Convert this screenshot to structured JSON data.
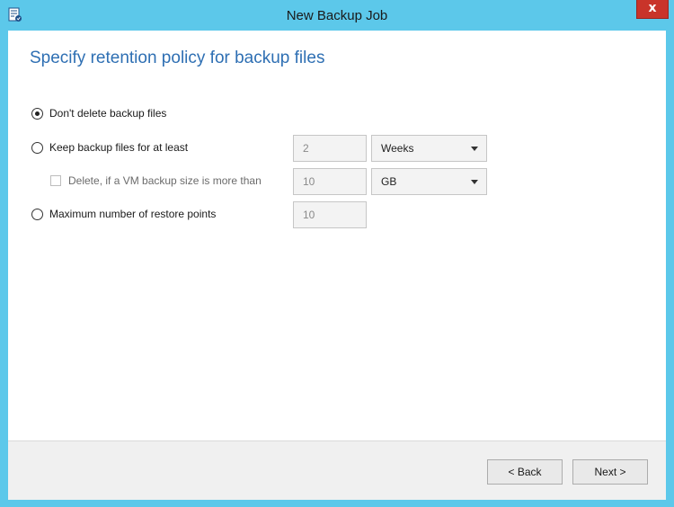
{
  "window": {
    "title": "New Backup Job",
    "close_label": "x",
    "icon": "backup-job-icon"
  },
  "page": {
    "heading": "Specify retention policy for backup files"
  },
  "options": {
    "dont_delete": {
      "label": "Don't delete backup files",
      "selected": true
    },
    "keep_at_least": {
      "label": "Keep backup files for at least",
      "selected": false,
      "value": "2",
      "unit": "Weeks"
    },
    "delete_if_size": {
      "label": "Delete, if a VM backup size is more than",
      "checked": false,
      "value": "10",
      "unit": "GB"
    },
    "max_restore_points": {
      "label": "Maximum number of restore points",
      "selected": false,
      "value": "10"
    }
  },
  "footer": {
    "back_label": "< Back",
    "next_label": "Next >"
  },
  "colors": {
    "titlebar": "#5cc8ea",
    "heading": "#2e6fb3",
    "close_button": "#c9342a"
  }
}
